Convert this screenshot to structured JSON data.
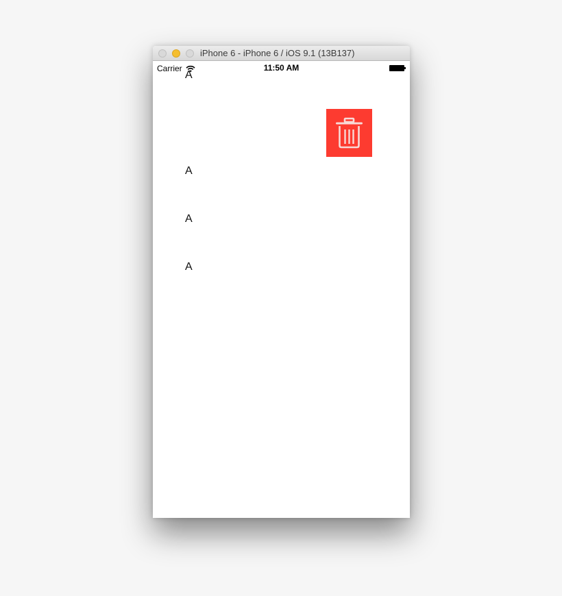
{
  "window": {
    "title": "iPhone 6 - iPhone 6 / iOS 9.1 (13B137)"
  },
  "status_bar": {
    "carrier": "Carrier",
    "time": "11:50 AM"
  },
  "list": {
    "items": [
      {
        "label": "A"
      },
      {
        "label": "A"
      },
      {
        "label": "A"
      },
      {
        "label": "A"
      }
    ]
  },
  "delete_action": {
    "icon": "trash-icon",
    "color": "#fd3b30"
  }
}
